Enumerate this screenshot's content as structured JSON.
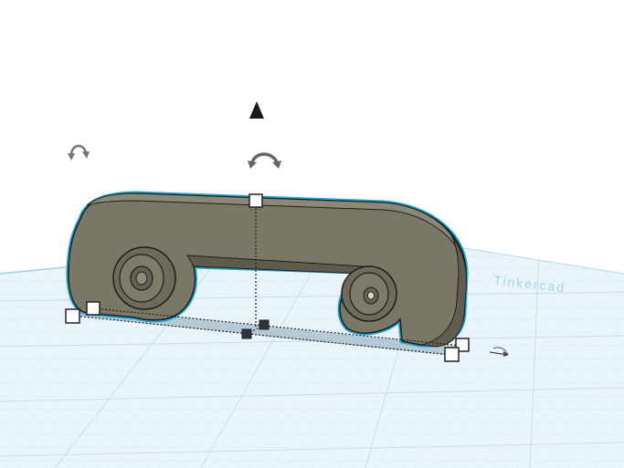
{
  "workspace": {
    "background_color": "#ffffff",
    "grid_color": "#cfe6f0",
    "plane_color": "#e8f4fa",
    "edge_text": "Tinkercad"
  },
  "selected_shape": {
    "type": "curved-bracket-with-wheels",
    "fill_color": "#7b7765",
    "highlight_color": "#19a8dc",
    "selected": true
  },
  "tools": {
    "lift_arrow_icon": "triangle-up-icon",
    "rotate_left_icon": "rotate-arrow-icon",
    "rotate_top_icon": "rotate-arrow-icon",
    "ruler_icon": "ruler-icon"
  }
}
